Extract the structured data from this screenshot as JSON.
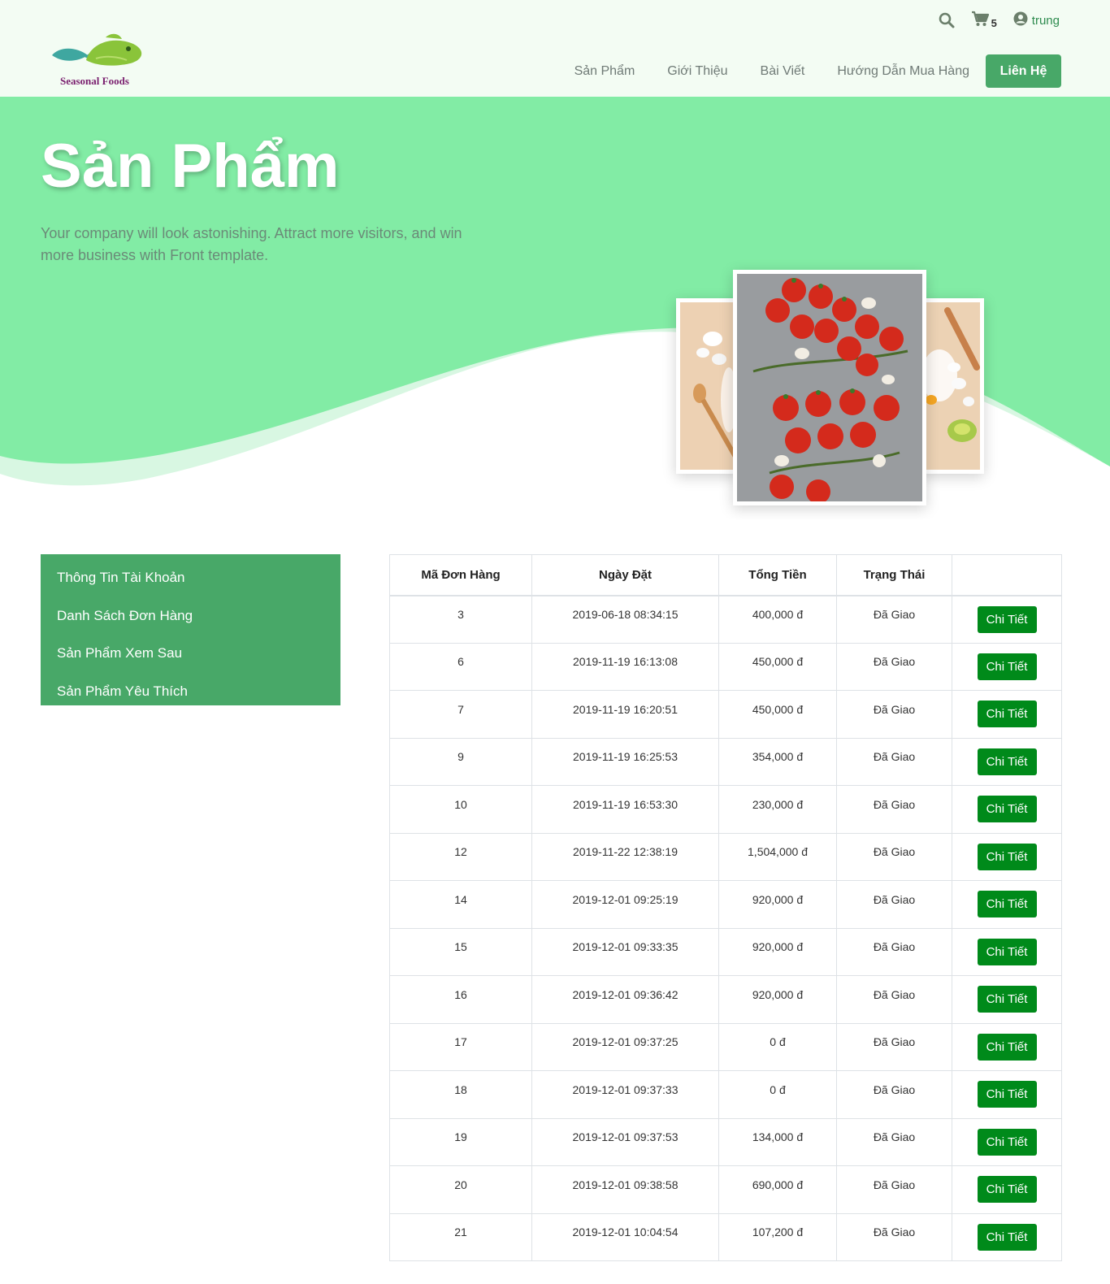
{
  "header": {
    "logo_text": "Seasonal Foods",
    "cart_count": "5",
    "username": "trung",
    "nav": [
      "Sản Phẩm",
      "Giới Thiệu",
      "Bài Viết",
      "Hướng Dẫn Mua Hàng"
    ],
    "contact_button": "Liên Hệ"
  },
  "hero": {
    "title": "Sản Phẩm",
    "subtitle": "Your company will look astonishing. Attract more visitors, and win more business with Front template."
  },
  "sidebar": {
    "items": [
      "Thông Tin Tài Khoản",
      "Danh Sách Đơn Hàng",
      "Sản Phẩm Xem Sau",
      "Sản Phẩm Yêu Thích"
    ]
  },
  "orders": {
    "headers": [
      "Mã Đơn Hàng",
      "Ngày Đặt",
      "Tổng Tiền",
      "Trạng Thái",
      ""
    ],
    "detail_label": "Chi Tiết",
    "rows": [
      {
        "id": "3",
        "date": "2019-06-18 08:34:15",
        "total": "400,000 đ",
        "status": "Đã Giao"
      },
      {
        "id": "6",
        "date": "2019-11-19 16:13:08",
        "total": "450,000 đ",
        "status": "Đã Giao"
      },
      {
        "id": "7",
        "date": "2019-11-19 16:20:51",
        "total": "450,000 đ",
        "status": "Đã Giao"
      },
      {
        "id": "9",
        "date": "2019-11-19 16:25:53",
        "total": "354,000 đ",
        "status": "Đã Giao"
      },
      {
        "id": "10",
        "date": "2019-11-19 16:53:30",
        "total": "230,000 đ",
        "status": "Đã Giao"
      },
      {
        "id": "12",
        "date": "2019-11-22 12:38:19",
        "total": "1,504,000 đ",
        "status": "Đã Giao"
      },
      {
        "id": "14",
        "date": "2019-12-01 09:25:19",
        "total": "920,000 đ",
        "status": "Đã Giao"
      },
      {
        "id": "15",
        "date": "2019-12-01 09:33:35",
        "total": "920,000 đ",
        "status": "Đã Giao"
      },
      {
        "id": "16",
        "date": "2019-12-01 09:36:42",
        "total": "920,000 đ",
        "status": "Đã Giao"
      },
      {
        "id": "17",
        "date": "2019-12-01 09:37:25",
        "total": "0 đ",
        "status": "Đã Giao"
      },
      {
        "id": "18",
        "date": "2019-12-01 09:37:33",
        "total": "0 đ",
        "status": "Đã Giao"
      },
      {
        "id": "19",
        "date": "2019-12-01 09:37:53",
        "total": "134,000 đ",
        "status": "Đã Giao"
      },
      {
        "id": "20",
        "date": "2019-12-01 09:38:58",
        "total": "690,000 đ",
        "status": "Đã Giao"
      },
      {
        "id": "21",
        "date": "2019-12-01 10:04:54",
        "total": "107,200 đ",
        "status": "Đã Giao"
      }
    ]
  },
  "colors": {
    "brand_green": "#48a868",
    "hero_green": "#82eca5",
    "header_bg": "#f3fcf3",
    "button_green": "#008a1a"
  },
  "icons": [
    "search-icon",
    "cart-icon",
    "user-circle-icon"
  ]
}
